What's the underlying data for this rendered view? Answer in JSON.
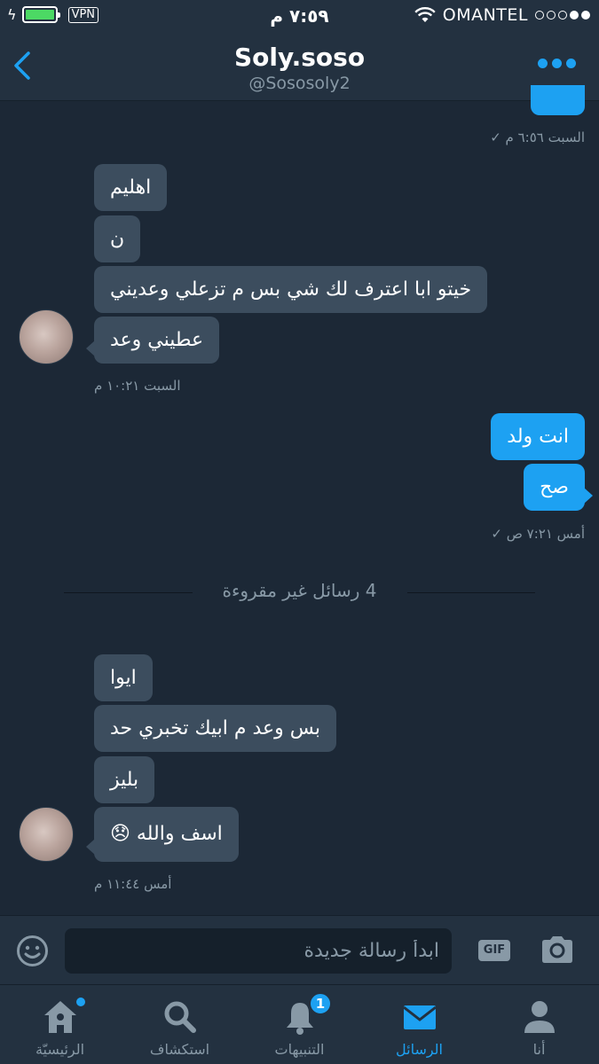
{
  "status_bar": {
    "vpn": "VPN",
    "time": "٧:٥٩ م",
    "carrier": "OMANTEL",
    "battery_level": 1.0,
    "signal_bars": 2
  },
  "header": {
    "title": "Soly.soso",
    "handle": "@Sososoly2"
  },
  "messages": {
    "ts_top": "السبت ٦:٥٦ م ✓",
    "m1": "اهليم",
    "m2": "ن",
    "m3": "خيتو ابا  اعترف لك شي بس م تزعلي وعديني",
    "m4": "عطيني وعد",
    "ts_1": "السبت ١٠:٢١ م",
    "o1": "انت ولد",
    "o2": "صح",
    "ts_2": "أمس ٧:٢١ ص ✓",
    "unread": "4 رسائل غير مقروءة",
    "m5": "ايوا",
    "m6": "بس وعد م ابيك تخبري حد",
    "m7": "بليز",
    "m8": "اسف والله 😞",
    "ts_3": "أمس ١١:٤٤ م"
  },
  "composer": {
    "placeholder": "ابدأ رسالة جديدة",
    "gif_label": "GIF"
  },
  "tabs": {
    "me": "أنا",
    "messages": "الرسائل",
    "notifications": "التنبيهات",
    "notifications_count": "1",
    "explore": "استكشاف",
    "home": "الرئيسيّة"
  },
  "colors": {
    "background": "#1c2836",
    "bar": "#233140",
    "accent": "#1da1f2",
    "incoming_bubble": "#3c4d5e",
    "muted_text": "#8899a6"
  }
}
